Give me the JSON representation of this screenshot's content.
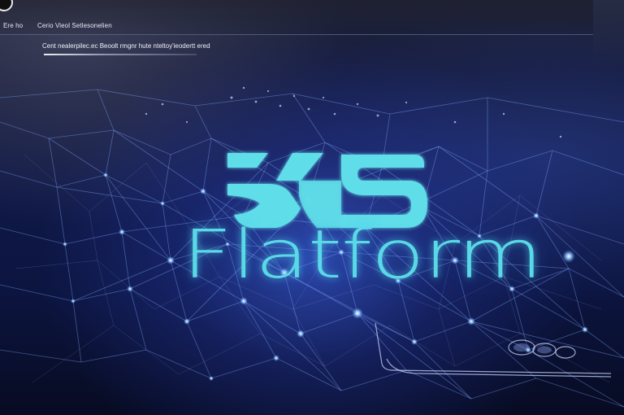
{
  "topbar": {
    "left_label": "Ere ho",
    "right_label": "Cerio Vieol Setlesonelien"
  },
  "search": {
    "text": "Cent nealerpilec.ec Beoolt rmgnr    hute nteltoy'ieodertt ered"
  },
  "logo": {
    "mark": "KS",
    "wordmark": "Flatform"
  },
  "colors": {
    "logo_cyan": "#59d9e6",
    "background_navy": "#101947",
    "network_glow": "#7fa8ff"
  }
}
